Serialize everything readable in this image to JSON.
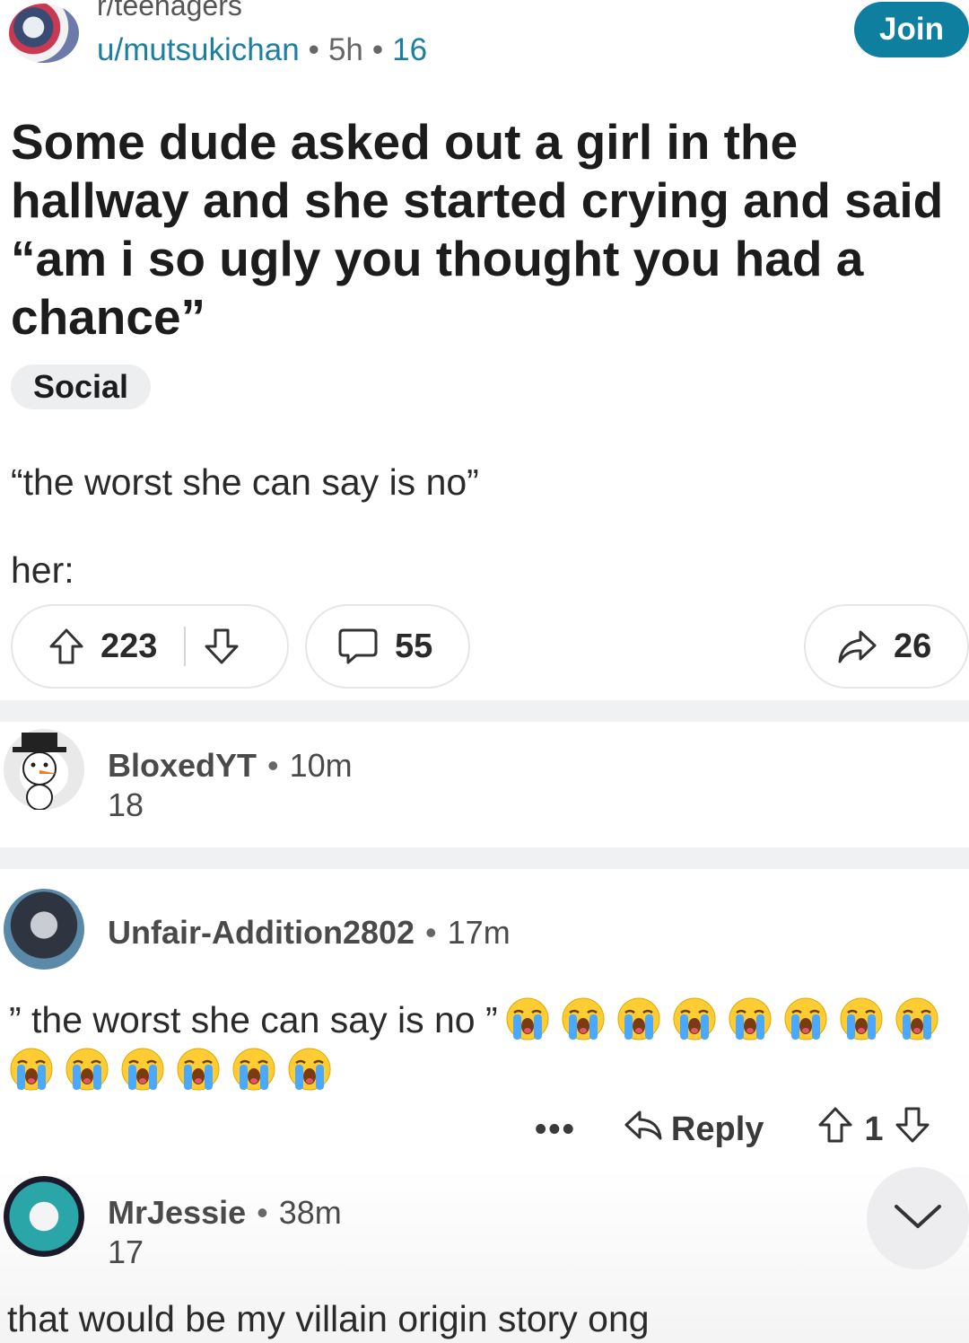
{
  "post": {
    "subreddit": "r/teenagers",
    "author": "u/mutsukichan",
    "age": "5h",
    "age_number": "16",
    "join_label": "Join",
    "title": "Some dude asked out a girl in the hallway and she started crying and said “am i so ugly you thought you had a chance”",
    "flair": "Social",
    "body_line1": "“the worst she can say is no”",
    "body_line2": "her:",
    "upvotes": "223",
    "comments": "55",
    "shares": "26"
  },
  "comments": [
    {
      "author": "BloxedYT",
      "time": "10m",
      "age_number": "18"
    },
    {
      "author": "Unfair-Addition2802",
      "time": "17m",
      "text": "” the worst she can say is no ”",
      "emoji": "loudly-crying-face",
      "emoji_count": 14,
      "reply_label": "Reply",
      "more_label": "•••",
      "score": "1"
    },
    {
      "author": "MrJessie",
      "time": "38m",
      "age_number": "17",
      "text": "that would be my villain origin story ong"
    }
  ],
  "colors": {
    "accent": "#0f7fa0",
    "link": "#1a7fa0",
    "divider": "#f0f1f3",
    "flair_bg": "#eceef0"
  }
}
